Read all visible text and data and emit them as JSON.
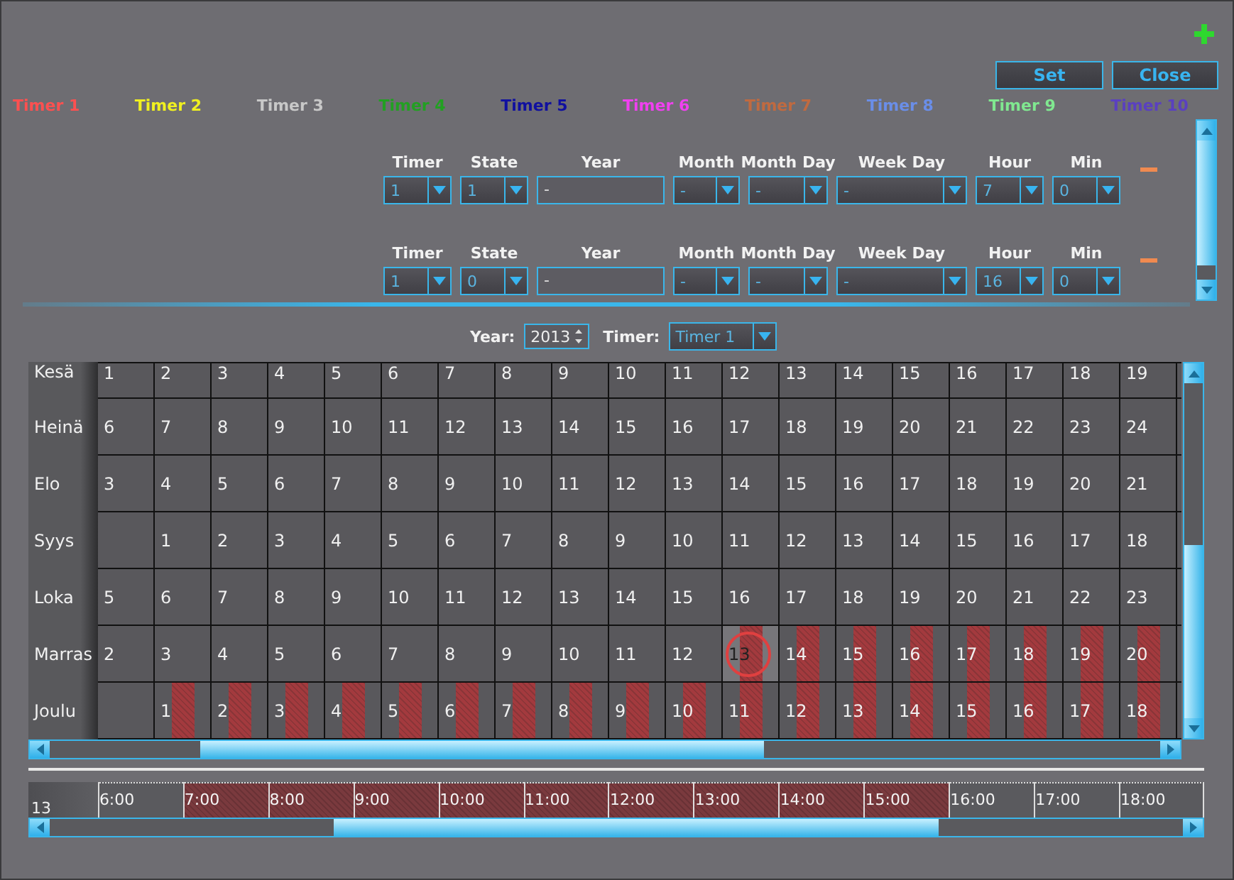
{
  "buttons": [
    {
      "label": "Set",
      "kind": "set"
    },
    {
      "label": "Close",
      "kind": "close"
    }
  ],
  "timers": [
    {
      "label": "Timer 1",
      "color": "#ff5050"
    },
    {
      "label": "Timer 2",
      "color": "#f0f020"
    },
    {
      "label": "Timer 3",
      "color": "#c8c8c8"
    },
    {
      "label": "Timer 4",
      "color": "#22a022"
    },
    {
      "label": "Timer 5",
      "color": "#1010a0"
    },
    {
      "label": "Timer 6",
      "color": "#f040f0"
    },
    {
      "label": "Timer 7",
      "color": "#c06a40"
    },
    {
      "label": "Timer 8",
      "color": "#6a8ee8"
    },
    {
      "label": "Timer 9",
      "color": "#80e890"
    },
    {
      "label": "Timer 10",
      "color": "#5a40c0"
    }
  ],
  "schedule": [
    {
      "fields": [
        {
          "label": "Timer",
          "value": "1",
          "kind": "dropdown"
        },
        {
          "label": "State",
          "value": "1",
          "kind": "dropdown"
        },
        {
          "label": "Year",
          "value": "-",
          "kind": "text"
        },
        {
          "label": "Month",
          "value": "-",
          "kind": "dropdown"
        },
        {
          "label": "Month Day",
          "value": "-",
          "kind": "dropdown"
        },
        {
          "label": "Week Day",
          "value": "-",
          "kind": "dropdown"
        },
        {
          "label": "Hour",
          "value": "7",
          "kind": "dropdown"
        },
        {
          "label": "Min",
          "value": "0",
          "kind": "dropdown"
        }
      ]
    },
    {
      "fields": [
        {
          "label": "Timer",
          "value": "1",
          "kind": "dropdown"
        },
        {
          "label": "State",
          "value": "0",
          "kind": "dropdown"
        },
        {
          "label": "Year",
          "value": "-",
          "kind": "text"
        },
        {
          "label": "Month",
          "value": "-",
          "kind": "dropdown"
        },
        {
          "label": "Month Day",
          "value": "-",
          "kind": "dropdown"
        },
        {
          "label": "Week Day",
          "value": "-",
          "kind": "dropdown"
        },
        {
          "label": "Hour",
          "value": "16",
          "kind": "dropdown"
        },
        {
          "label": "Min",
          "value": "0",
          "kind": "dropdown"
        }
      ]
    }
  ],
  "calendar": {
    "year_label": "Year:",
    "year": "2013",
    "timer_label": "Timer:",
    "timer": "Timer 1",
    "months": [
      {
        "name": "Kesä",
        "days": [
          {
            "day": "1",
            "marked": false,
            "today": false
          },
          {
            "day": "2",
            "marked": false,
            "today": false
          },
          {
            "day": "3",
            "marked": false,
            "today": false
          },
          {
            "day": "4",
            "marked": false,
            "today": false
          },
          {
            "day": "5",
            "marked": false,
            "today": false
          },
          {
            "day": "6",
            "marked": false,
            "today": false
          },
          {
            "day": "7",
            "marked": false,
            "today": false
          },
          {
            "day": "8",
            "marked": false,
            "today": false
          },
          {
            "day": "9",
            "marked": false,
            "today": false
          },
          {
            "day": "10",
            "marked": false,
            "today": false
          },
          {
            "day": "11",
            "marked": false,
            "today": false
          },
          {
            "day": "12",
            "marked": false,
            "today": false
          },
          {
            "day": "13",
            "marked": false,
            "today": false
          },
          {
            "day": "14",
            "marked": false,
            "today": false
          },
          {
            "day": "15",
            "marked": false,
            "today": false
          },
          {
            "day": "16",
            "marked": false,
            "today": false
          },
          {
            "day": "17",
            "marked": false,
            "today": false
          },
          {
            "day": "18",
            "marked": false,
            "today": false
          },
          {
            "day": "19",
            "marked": false,
            "today": false
          }
        ]
      },
      {
        "name": "Heinä",
        "days": [
          {
            "day": "6",
            "marked": false,
            "today": false
          },
          {
            "day": "7",
            "marked": false,
            "today": false
          },
          {
            "day": "8",
            "marked": false,
            "today": false
          },
          {
            "day": "9",
            "marked": false,
            "today": false
          },
          {
            "day": "10",
            "marked": false,
            "today": false
          },
          {
            "day": "11",
            "marked": false,
            "today": false
          },
          {
            "day": "12",
            "marked": false,
            "today": false
          },
          {
            "day": "13",
            "marked": false,
            "today": false
          },
          {
            "day": "14",
            "marked": false,
            "today": false
          },
          {
            "day": "15",
            "marked": false,
            "today": false
          },
          {
            "day": "16",
            "marked": false,
            "today": false
          },
          {
            "day": "17",
            "marked": false,
            "today": false
          },
          {
            "day": "18",
            "marked": false,
            "today": false
          },
          {
            "day": "19",
            "marked": false,
            "today": false
          },
          {
            "day": "20",
            "marked": false,
            "today": false
          },
          {
            "day": "21",
            "marked": false,
            "today": false
          },
          {
            "day": "22",
            "marked": false,
            "today": false
          },
          {
            "day": "23",
            "marked": false,
            "today": false
          },
          {
            "day": "24",
            "marked": false,
            "today": false
          }
        ]
      },
      {
        "name": "Elo",
        "days": [
          {
            "day": "3",
            "marked": false,
            "today": false
          },
          {
            "day": "4",
            "marked": false,
            "today": false
          },
          {
            "day": "5",
            "marked": false,
            "today": false
          },
          {
            "day": "6",
            "marked": false,
            "today": false
          },
          {
            "day": "7",
            "marked": false,
            "today": false
          },
          {
            "day": "8",
            "marked": false,
            "today": false
          },
          {
            "day": "9",
            "marked": false,
            "today": false
          },
          {
            "day": "10",
            "marked": false,
            "today": false
          },
          {
            "day": "11",
            "marked": false,
            "today": false
          },
          {
            "day": "12",
            "marked": false,
            "today": false
          },
          {
            "day": "13",
            "marked": false,
            "today": false
          },
          {
            "day": "14",
            "marked": false,
            "today": false
          },
          {
            "day": "15",
            "marked": false,
            "today": false
          },
          {
            "day": "16",
            "marked": false,
            "today": false
          },
          {
            "day": "17",
            "marked": false,
            "today": false
          },
          {
            "day": "18",
            "marked": false,
            "today": false
          },
          {
            "day": "19",
            "marked": false,
            "today": false
          },
          {
            "day": "20",
            "marked": false,
            "today": false
          },
          {
            "day": "21",
            "marked": false,
            "today": false
          }
        ]
      },
      {
        "name": "Syys",
        "days": [
          {
            "marked": false,
            "today": false
          },
          {
            "day": "1",
            "marked": false,
            "today": false
          },
          {
            "day": "2",
            "marked": false,
            "today": false
          },
          {
            "day": "3",
            "marked": false,
            "today": false
          },
          {
            "day": "4",
            "marked": false,
            "today": false
          },
          {
            "day": "5",
            "marked": false,
            "today": false
          },
          {
            "day": "6",
            "marked": false,
            "today": false
          },
          {
            "day": "7",
            "marked": false,
            "today": false
          },
          {
            "day": "8",
            "marked": false,
            "today": false
          },
          {
            "day": "9",
            "marked": false,
            "today": false
          },
          {
            "day": "10",
            "marked": false,
            "today": false
          },
          {
            "day": "11",
            "marked": false,
            "today": false
          },
          {
            "day": "12",
            "marked": false,
            "today": false
          },
          {
            "day": "13",
            "marked": false,
            "today": false
          },
          {
            "day": "14",
            "marked": false,
            "today": false
          },
          {
            "day": "15",
            "marked": false,
            "today": false
          },
          {
            "day": "16",
            "marked": false,
            "today": false
          },
          {
            "day": "17",
            "marked": false,
            "today": false
          },
          {
            "day": "18",
            "marked": false,
            "today": false
          }
        ]
      },
      {
        "name": "Loka",
        "days": [
          {
            "day": "5",
            "marked": false,
            "today": false
          },
          {
            "day": "6",
            "marked": false,
            "today": false
          },
          {
            "day": "7",
            "marked": false,
            "today": false
          },
          {
            "day": "8",
            "marked": false,
            "today": false
          },
          {
            "day": "9",
            "marked": false,
            "today": false
          },
          {
            "day": "10",
            "marked": false,
            "today": false
          },
          {
            "day": "11",
            "marked": false,
            "today": false
          },
          {
            "day": "12",
            "marked": false,
            "today": false
          },
          {
            "day": "13",
            "marked": false,
            "today": false
          },
          {
            "day": "14",
            "marked": false,
            "today": false
          },
          {
            "day": "15",
            "marked": false,
            "today": false
          },
          {
            "day": "16",
            "marked": false,
            "today": false
          },
          {
            "day": "17",
            "marked": false,
            "today": false
          },
          {
            "day": "18",
            "marked": false,
            "today": false
          },
          {
            "day": "19",
            "marked": false,
            "today": false
          },
          {
            "day": "20",
            "marked": false,
            "today": false
          },
          {
            "day": "21",
            "marked": false,
            "today": false
          },
          {
            "day": "22",
            "marked": false,
            "today": false
          },
          {
            "day": "23",
            "marked": false,
            "today": false
          }
        ]
      },
      {
        "name": "Marras",
        "days": [
          {
            "day": "2",
            "marked": false,
            "today": false
          },
          {
            "day": "3",
            "marked": false,
            "today": false
          },
          {
            "day": "4",
            "marked": false,
            "today": false
          },
          {
            "day": "5",
            "marked": false,
            "today": false
          },
          {
            "day": "6",
            "marked": false,
            "today": false
          },
          {
            "day": "7",
            "marked": false,
            "today": false
          },
          {
            "day": "8",
            "marked": false,
            "today": false
          },
          {
            "day": "9",
            "marked": false,
            "today": false
          },
          {
            "day": "10",
            "marked": false,
            "today": false
          },
          {
            "day": "11",
            "marked": false,
            "today": false
          },
          {
            "day": "12",
            "marked": false,
            "today": false
          },
          {
            "day": "13",
            "marked": true,
            "today": true
          },
          {
            "day": "14",
            "marked": true,
            "today": false
          },
          {
            "day": "15",
            "marked": true,
            "today": false
          },
          {
            "day": "16",
            "marked": true,
            "today": false
          },
          {
            "day": "17",
            "marked": true,
            "today": false
          },
          {
            "day": "18",
            "marked": true,
            "today": false
          },
          {
            "day": "19",
            "marked": true,
            "today": false
          },
          {
            "day": "20",
            "marked": true,
            "today": false
          }
        ]
      },
      {
        "name": "Joulu",
        "days": [
          {
            "marked": false,
            "today": false
          },
          {
            "day": "1",
            "marked": true,
            "today": false
          },
          {
            "day": "2",
            "marked": true,
            "today": false
          },
          {
            "day": "3",
            "marked": true,
            "today": false
          },
          {
            "day": "4",
            "marked": true,
            "today": false
          },
          {
            "day": "5",
            "marked": true,
            "today": false
          },
          {
            "day": "6",
            "marked": true,
            "today": false
          },
          {
            "day": "7",
            "marked": true,
            "today": false
          },
          {
            "day": "8",
            "marked": true,
            "today": false
          },
          {
            "day": "9",
            "marked": true,
            "today": false
          },
          {
            "day": "10",
            "marked": true,
            "today": false
          },
          {
            "day": "11",
            "marked": true,
            "today": false
          },
          {
            "day": "12",
            "marked": true,
            "today": false
          },
          {
            "day": "13",
            "marked": true,
            "today": false
          },
          {
            "day": "14",
            "marked": true,
            "today": false
          },
          {
            "day": "15",
            "marked": true,
            "today": false
          },
          {
            "day": "16",
            "marked": true,
            "today": false
          },
          {
            "day": "17",
            "marked": true,
            "today": false
          },
          {
            "day": "18",
            "marked": true,
            "today": false
          }
        ]
      }
    ]
  },
  "timeline": {
    "day": "13",
    "slots": [
      {
        "label": "6:00",
        "marked": false
      },
      {
        "label": "7:00",
        "marked": true
      },
      {
        "label": "8:00",
        "marked": true
      },
      {
        "label": "9:00",
        "marked": true
      },
      {
        "label": "10:00",
        "marked": true
      },
      {
        "label": "11:00",
        "marked": true
      },
      {
        "label": "12:00",
        "marked": true
      },
      {
        "label": "13:00",
        "marked": true
      },
      {
        "label": "14:00",
        "marked": true
      },
      {
        "label": "15:00",
        "marked": true
      },
      {
        "label": "16:00",
        "marked": false
      },
      {
        "label": "17:00",
        "marked": false
      },
      {
        "label": "18:00",
        "marked": false
      }
    ]
  }
}
